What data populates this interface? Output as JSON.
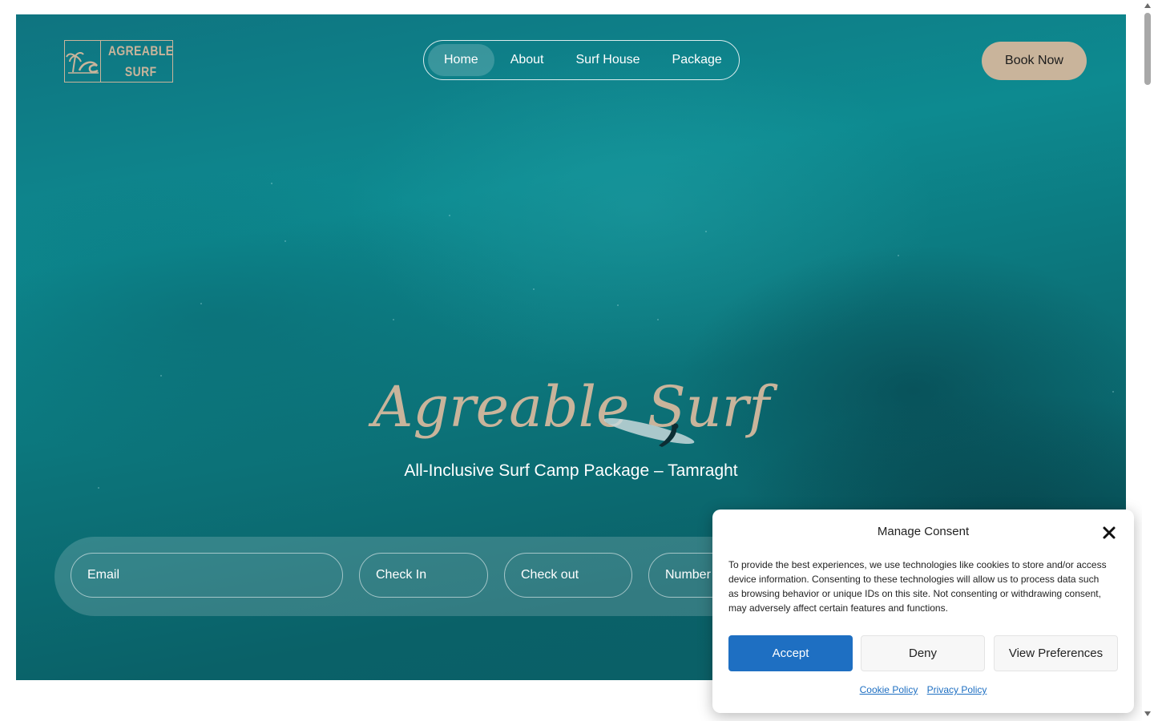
{
  "logo": {
    "line1": "AGREABLE",
    "line2": "SURF",
    "icon": "palm-wave-icon"
  },
  "nav": {
    "items": [
      {
        "label": "Home",
        "active": true
      },
      {
        "label": "About",
        "active": false
      },
      {
        "label": "Surf House",
        "active": false
      },
      {
        "label": "Package",
        "active": false
      }
    ]
  },
  "header": {
    "book_now_label": "Book Now"
  },
  "hero": {
    "title": "Agreable Surf",
    "subtitle": "All-Inclusive Surf Camp Package – Tamraght"
  },
  "booking": {
    "email_placeholder": "Email",
    "checkin_placeholder": "Check In",
    "checkout_placeholder": "Check out",
    "number_placeholder": "Number"
  },
  "consent": {
    "title": "Manage Consent",
    "body": "To provide the best experiences, we use technologies like cookies to store and/or access device information. Consenting to these technologies will allow us to process data such as browsing behavior or unique IDs on this site. Not consenting or withdrawing consent, may adversely affect certain features and functions.",
    "accept_label": "Accept",
    "deny_label": "Deny",
    "preferences_label": "View Preferences",
    "cookie_policy_label": "Cookie Policy",
    "privacy_policy_label": "Privacy Policy",
    "close_icon": "close-icon"
  },
  "colors": {
    "accent": "#c9b49b",
    "primary_button": "#1e6fc2",
    "sea": "#0d7f86"
  }
}
